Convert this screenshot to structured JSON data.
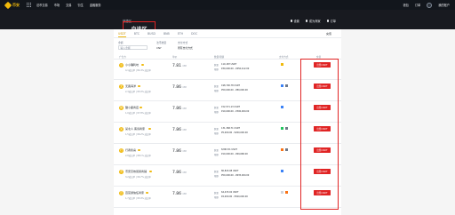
{
  "nav": {
    "logo": "币安",
    "menu": [
      "法币交易",
      "市场",
      "交易",
      "衍生",
      "金融服务"
    ],
    "right": [
      "钱包",
      "订单",
      "我的账户"
    ]
  },
  "hero": {
    "tabs": [
      "快捷区",
      "自选区"
    ],
    "title": "自选区",
    "actions": [
      "设置",
      "成为商家",
      "订单"
    ]
  },
  "coin_tabs": [
    "USDT",
    "BTC",
    "BUSD",
    "BNB",
    "ETH",
    "DOC"
  ],
  "recharge": "充值",
  "filters": {
    "amount_label": "金额",
    "amount_placeholder": "输入金额",
    "currency_label": "法币类型",
    "currency_value": "CNY",
    "pay_label": "支付方式",
    "pay_value": "所有支付方式"
  },
  "headers": [
    "广告方",
    "单价",
    "数量/限额",
    "支付方式",
    "交易"
  ],
  "accent": "#f0b90b",
  "buy_color": "#e02424",
  "rows": [
    {
      "name": "小小确利坊",
      "initial": "小",
      "stats": "4,1成交单 | 84.4% 成交率",
      "price": "7.81",
      "unit": "CNY",
      "qty_label": "数量",
      "qty": "110,187 USDT",
      "lim_label": "限额",
      "limit": "¥30,000.00 - ¥450,412.00",
      "buy": "出售USDT"
    },
    {
      "name": "无畏海洋",
      "initial": "无",
      "stats": "2,3成交单 | 95.0% 成交率",
      "price": "7.86",
      "unit": "CNY",
      "qty_label": "数量",
      "qty": "198,700.78 USDT",
      "lim_label": "限额",
      "limit": "¥50,000.00 - ¥80,000.00",
      "buy": "出售USDT"
    },
    {
      "name": "酷小鹿商店",
      "initial": "酷",
      "stats": "1,0成交单 | 97.8% 成交率",
      "price": "7.86",
      "unit": "CNY",
      "qty_label": "数量",
      "qty": "152,571.13 USDT",
      "lim_label": "限额",
      "limit": "¥10,000.00 - ¥300,000.00",
      "buy": "出售USDT"
    },
    {
      "name": "某北人 客诉商家",
      "initial": "某",
      "stats": "1,5成交单 | 96.2% 成交率",
      "price": "7.86",
      "unit": "CNY",
      "qty_label": "数量",
      "qty": "131,368.71 USDT",
      "lim_label": "限额",
      "limit": "¥5,000.00 - ¥200,000.00",
      "buy": "出售USDT"
    },
    {
      "name": "行者永喜",
      "initial": "行",
      "stats": "2,8成交单 | 98.1% 成交率",
      "price": "7.86",
      "unit": "CNY",
      "qty_label": "数量",
      "qty": "8,863.51 USDT",
      "lim_label": "限额",
      "limit": "¥10,000.00 - ¥69,668.00",
      "buy": "出售USDT"
    },
    {
      "name": "币安高效贸易商铺",
      "initial": "币",
      "stats": "3,2成交单 | 96.7% 成交率",
      "price": "7.86",
      "unit": "CNY",
      "qty_label": "数量",
      "qty": "80,843.08 USDT",
      "lim_label": "限额",
      "limit": "¥50,000.00 - ¥635,000.00",
      "buy": "出售USDT"
    },
    {
      "name": "百富通信任商家",
      "initial": "百",
      "stats": "1,7成交单 | 95.9% 成交率",
      "price": "7.86",
      "unit": "CNY",
      "qty_label": "数量",
      "qty": "64,433.02 USDT",
      "lim_label": "限额",
      "limit": "¥2,000.00 - ¥500,000.00",
      "buy": "出售USDT"
    }
  ]
}
